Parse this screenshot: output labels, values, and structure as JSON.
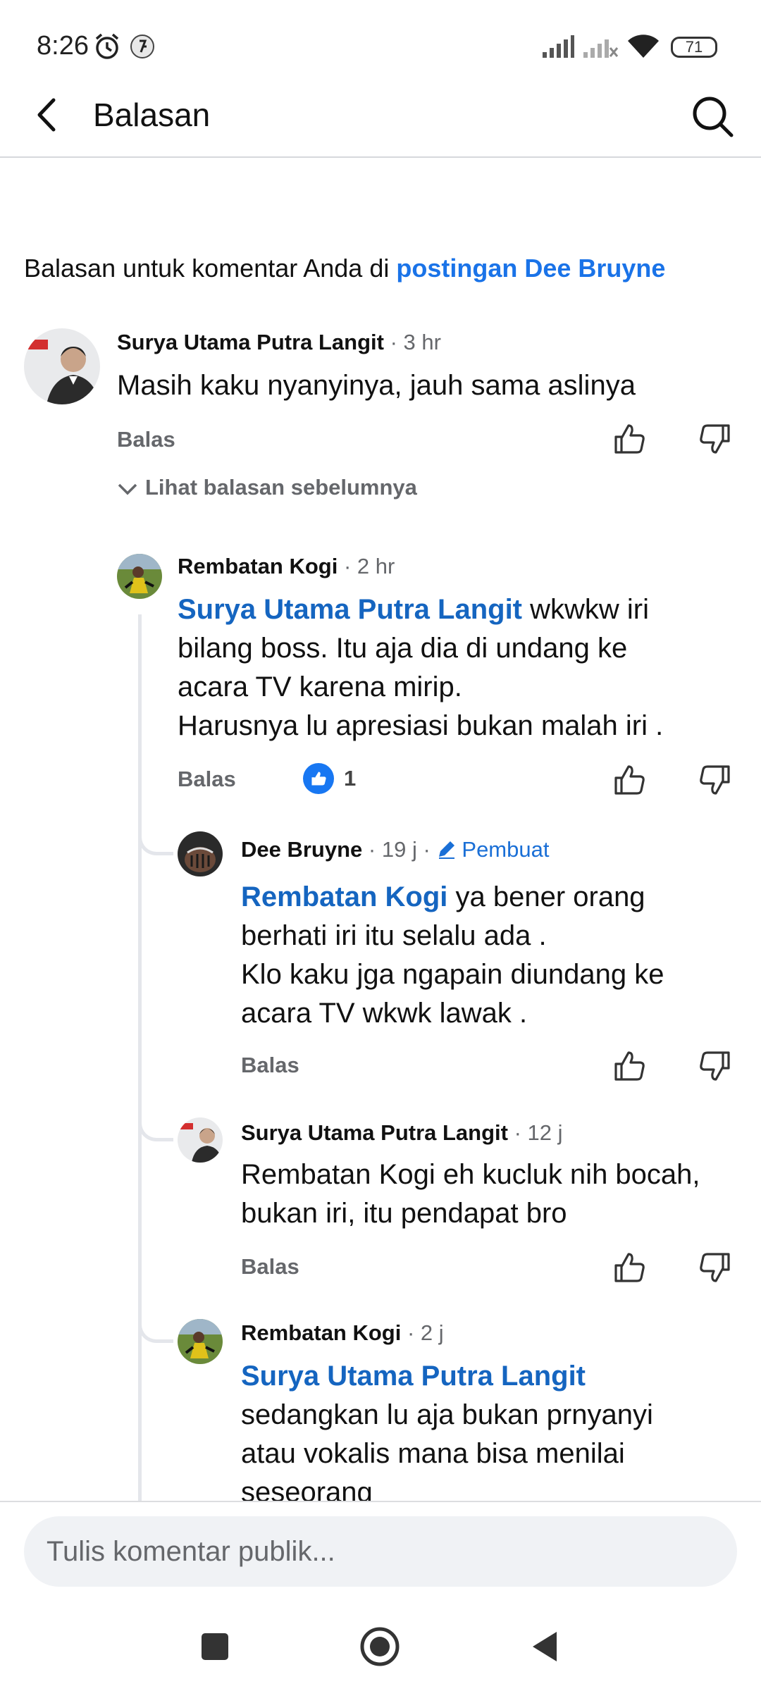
{
  "status_bar": {
    "time": "8:26",
    "battery": "71",
    "icons": [
      "alarm-icon",
      "app-notification-icon",
      "signal-icon",
      "signal-off-icon",
      "wifi-icon",
      "battery-icon"
    ]
  },
  "header": {
    "title": "Balasan",
    "back_icon": "chevron-left-icon",
    "search_icon": "search-icon"
  },
  "intro": {
    "text": "Balasan untuk komentar Anda di ",
    "link": "postingan Dee Bruyne"
  },
  "reply_label": "Balas",
  "view_previous": "Lihat balasan sebelumnya",
  "comments": [
    {
      "author": "Surya Utama Putra Langit",
      "meta": " · 3 hr",
      "lines": [
        "Masih kaku nyanyinya, jauh sama aslinya"
      ]
    },
    {
      "author": "Rembatan Kogi",
      "meta": " · 2 hr",
      "mention": "Surya Utama Putra Langit",
      "lines": [
        "  wkwkw iri",
        "bilang boss. Itu aja dia di undang ke",
        "acara TV karena mirip.",
        "Harusnya lu apresiasi bukan malah iri ."
      ],
      "reaction_count": "1"
    },
    {
      "author": "Dee Bruyne",
      "meta": " · 19 j · ",
      "creator_label": "Pembuat",
      "mention": "Rembatan Kogi",
      "lines": [
        " ya bener orang",
        "berhati iri itu selalu ada  .",
        "Klo kaku jga ngapain diundang ke",
        "acara TV wkwk lawak ."
      ]
    },
    {
      "author": "Surya Utama Putra Langit",
      "meta": " · 12 j",
      "lines": [
        "Rembatan Kogi eh kucluk nih bocah,",
        "bukan iri, itu pendapat bro"
      ]
    },
    {
      "author": "Rembatan Kogi",
      "meta": " · 2 j",
      "mention": "Surya Utama Putra Langit",
      "lines": [
        "sedangkan lu aja bukan prnyanyi",
        "atau vokalis mana bisa menilai",
        "seseorang"
      ]
    }
  ],
  "composer": {
    "placeholder": "Tulis komentar publik..."
  },
  "nav": {
    "icons": [
      "recents-square-icon",
      "home-circle-icon",
      "back-triangle-icon"
    ]
  },
  "colors": {
    "link_blue": "#1a73e8",
    "mention_blue": "#1565c0",
    "like_badge": "#1877f2",
    "muted_text": "#65676b"
  }
}
